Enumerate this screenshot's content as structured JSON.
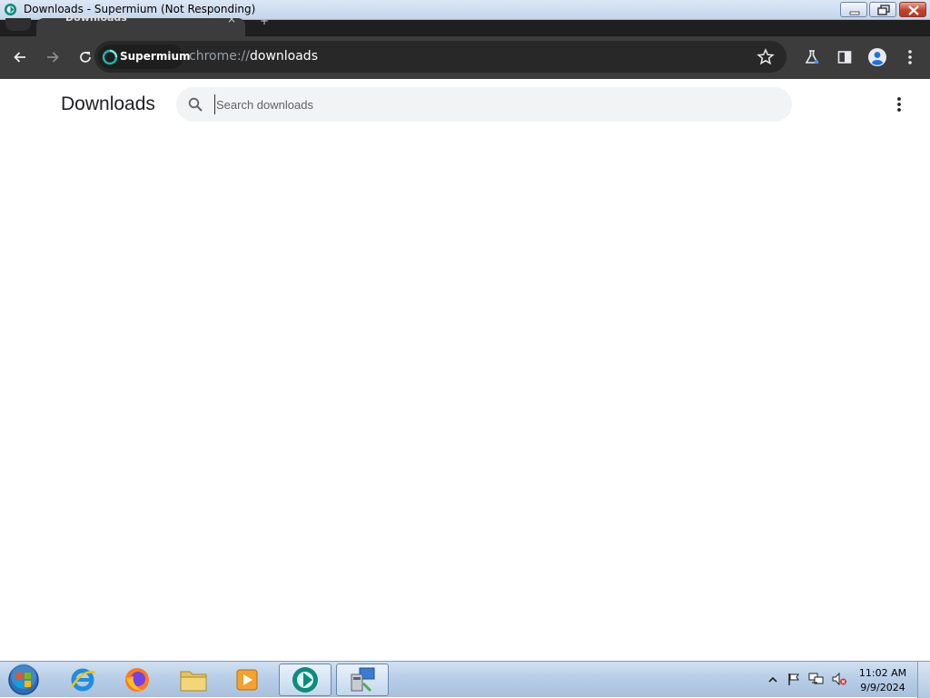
{
  "window": {
    "title": "Downloads - Supermium (Not Responding)"
  },
  "tab": {
    "title": "Downloads",
    "close_glyph": "×",
    "new_tab_glyph": "+"
  },
  "toolbar": {
    "chip_label": "Supermium",
    "url_scheme": "chrome://",
    "url_path": "downloads"
  },
  "page": {
    "title": "Downloads",
    "search_placeholder": "Search downloads"
  },
  "taskbar": {
    "apps": [
      "start-orb",
      "internet-explorer",
      "firefox",
      "file-explorer",
      "media-player",
      "supermium",
      "control-panel"
    ],
    "clock_time": "11:02 AM",
    "clock_date": "9/9/2024"
  },
  "colors": {
    "toolbar_bg": "#3c3c3c",
    "omnibox_bg": "#282828",
    "search_bg": "#f1f3f4",
    "taskbar_bg": "#b7cde6",
    "accent_teal": "#00bfa5"
  }
}
